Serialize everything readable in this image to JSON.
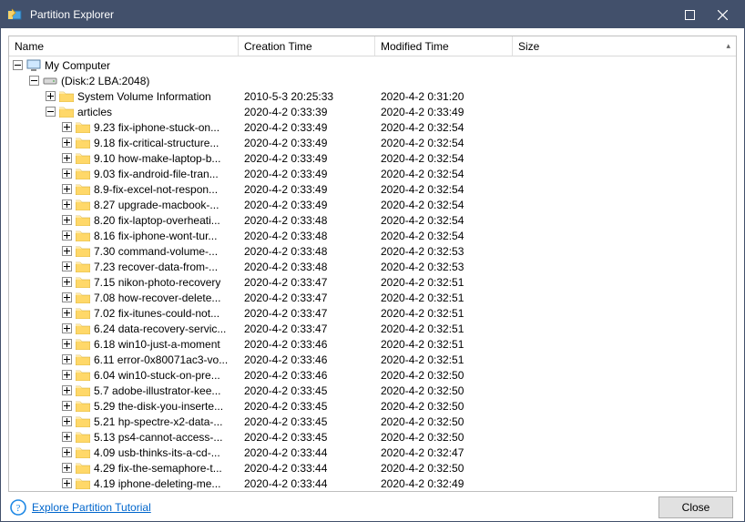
{
  "window": {
    "title": "Partition Explorer"
  },
  "columns": {
    "name": "Name",
    "ctime": "Creation Time",
    "mtime": "Modified Time",
    "size": "Size"
  },
  "tree": {
    "root": {
      "label": "My Computer",
      "expanded": true
    },
    "disk": {
      "label": "(Disk:2 LBA:2048)",
      "expanded": true
    },
    "sysvol": {
      "label": "System Volume Information",
      "ctime": "2010-5-3 20:25:33",
      "mtime": "2020-4-2 0:31:20"
    },
    "articles": {
      "label": "articles",
      "ctime": "2020-4-2 0:33:39",
      "mtime": "2020-4-2 0:33:49",
      "expanded": true
    },
    "items": [
      {
        "label": "9.23 fix-iphone-stuck-on...",
        "ctime": "2020-4-2 0:33:49",
        "mtime": "2020-4-2 0:32:54"
      },
      {
        "label": "9.18 fix-critical-structure...",
        "ctime": "2020-4-2 0:33:49",
        "mtime": "2020-4-2 0:32:54"
      },
      {
        "label": "9.10 how-make-laptop-b...",
        "ctime": "2020-4-2 0:33:49",
        "mtime": "2020-4-2 0:32:54"
      },
      {
        "label": "9.03 fix-android-file-tran...",
        "ctime": "2020-4-2 0:33:49",
        "mtime": "2020-4-2 0:32:54"
      },
      {
        "label": "8.9-fix-excel-not-respon...",
        "ctime": "2020-4-2 0:33:49",
        "mtime": "2020-4-2 0:32:54"
      },
      {
        "label": "8.27 upgrade-macbook-...",
        "ctime": "2020-4-2 0:33:49",
        "mtime": "2020-4-2 0:32:54"
      },
      {
        "label": "8.20 fix-laptop-overheati...",
        "ctime": "2020-4-2 0:33:48",
        "mtime": "2020-4-2 0:32:54"
      },
      {
        "label": "8.16 fix-iphone-wont-tur...",
        "ctime": "2020-4-2 0:33:48",
        "mtime": "2020-4-2 0:32:54"
      },
      {
        "label": "7.30 command-volume-...",
        "ctime": "2020-4-2 0:33:48",
        "mtime": "2020-4-2 0:32:53"
      },
      {
        "label": "7.23 recover-data-from-...",
        "ctime": "2020-4-2 0:33:48",
        "mtime": "2020-4-2 0:32:53"
      },
      {
        "label": "7.15 nikon-photo-recovery",
        "ctime": "2020-4-2 0:33:47",
        "mtime": "2020-4-2 0:32:51"
      },
      {
        "label": "7.08 how-recover-delete...",
        "ctime": "2020-4-2 0:33:47",
        "mtime": "2020-4-2 0:32:51"
      },
      {
        "label": "7.02 fix-itunes-could-not...",
        "ctime": "2020-4-2 0:33:47",
        "mtime": "2020-4-2 0:32:51"
      },
      {
        "label": "6.24 data-recovery-servic...",
        "ctime": "2020-4-2 0:33:47",
        "mtime": "2020-4-2 0:32:51"
      },
      {
        "label": "6.18 win10-just-a-moment",
        "ctime": "2020-4-2 0:33:46",
        "mtime": "2020-4-2 0:32:51"
      },
      {
        "label": "6.11 error-0x80071ac3-vo...",
        "ctime": "2020-4-2 0:33:46",
        "mtime": "2020-4-2 0:32:51"
      },
      {
        "label": "6.04 win10-stuck-on-pre...",
        "ctime": "2020-4-2 0:33:46",
        "mtime": "2020-4-2 0:32:50"
      },
      {
        "label": "5.7 adobe-illustrator-kee...",
        "ctime": "2020-4-2 0:33:45",
        "mtime": "2020-4-2 0:32:50"
      },
      {
        "label": "5.29 the-disk-you-inserte...",
        "ctime": "2020-4-2 0:33:45",
        "mtime": "2020-4-2 0:32:50"
      },
      {
        "label": "5.21 hp-spectre-x2-data-...",
        "ctime": "2020-4-2 0:33:45",
        "mtime": "2020-4-2 0:32:50"
      },
      {
        "label": "5.13 ps4-cannot-access-...",
        "ctime": "2020-4-2 0:33:45",
        "mtime": "2020-4-2 0:32:50"
      },
      {
        "label": "4.09 usb-thinks-its-a-cd-...",
        "ctime": "2020-4-2 0:33:44",
        "mtime": "2020-4-2 0:32:47"
      },
      {
        "label": "4.29 fix-the-semaphore-t...",
        "ctime": "2020-4-2 0:33:44",
        "mtime": "2020-4-2 0:32:50"
      },
      {
        "label": "4.19 iphone-deleting-me...",
        "ctime": "2020-4-2 0:33:44",
        "mtime": "2020-4-2 0:32:49"
      }
    ]
  },
  "footer": {
    "tutorial": "Explore Partition Tutorial",
    "close": "Close"
  }
}
